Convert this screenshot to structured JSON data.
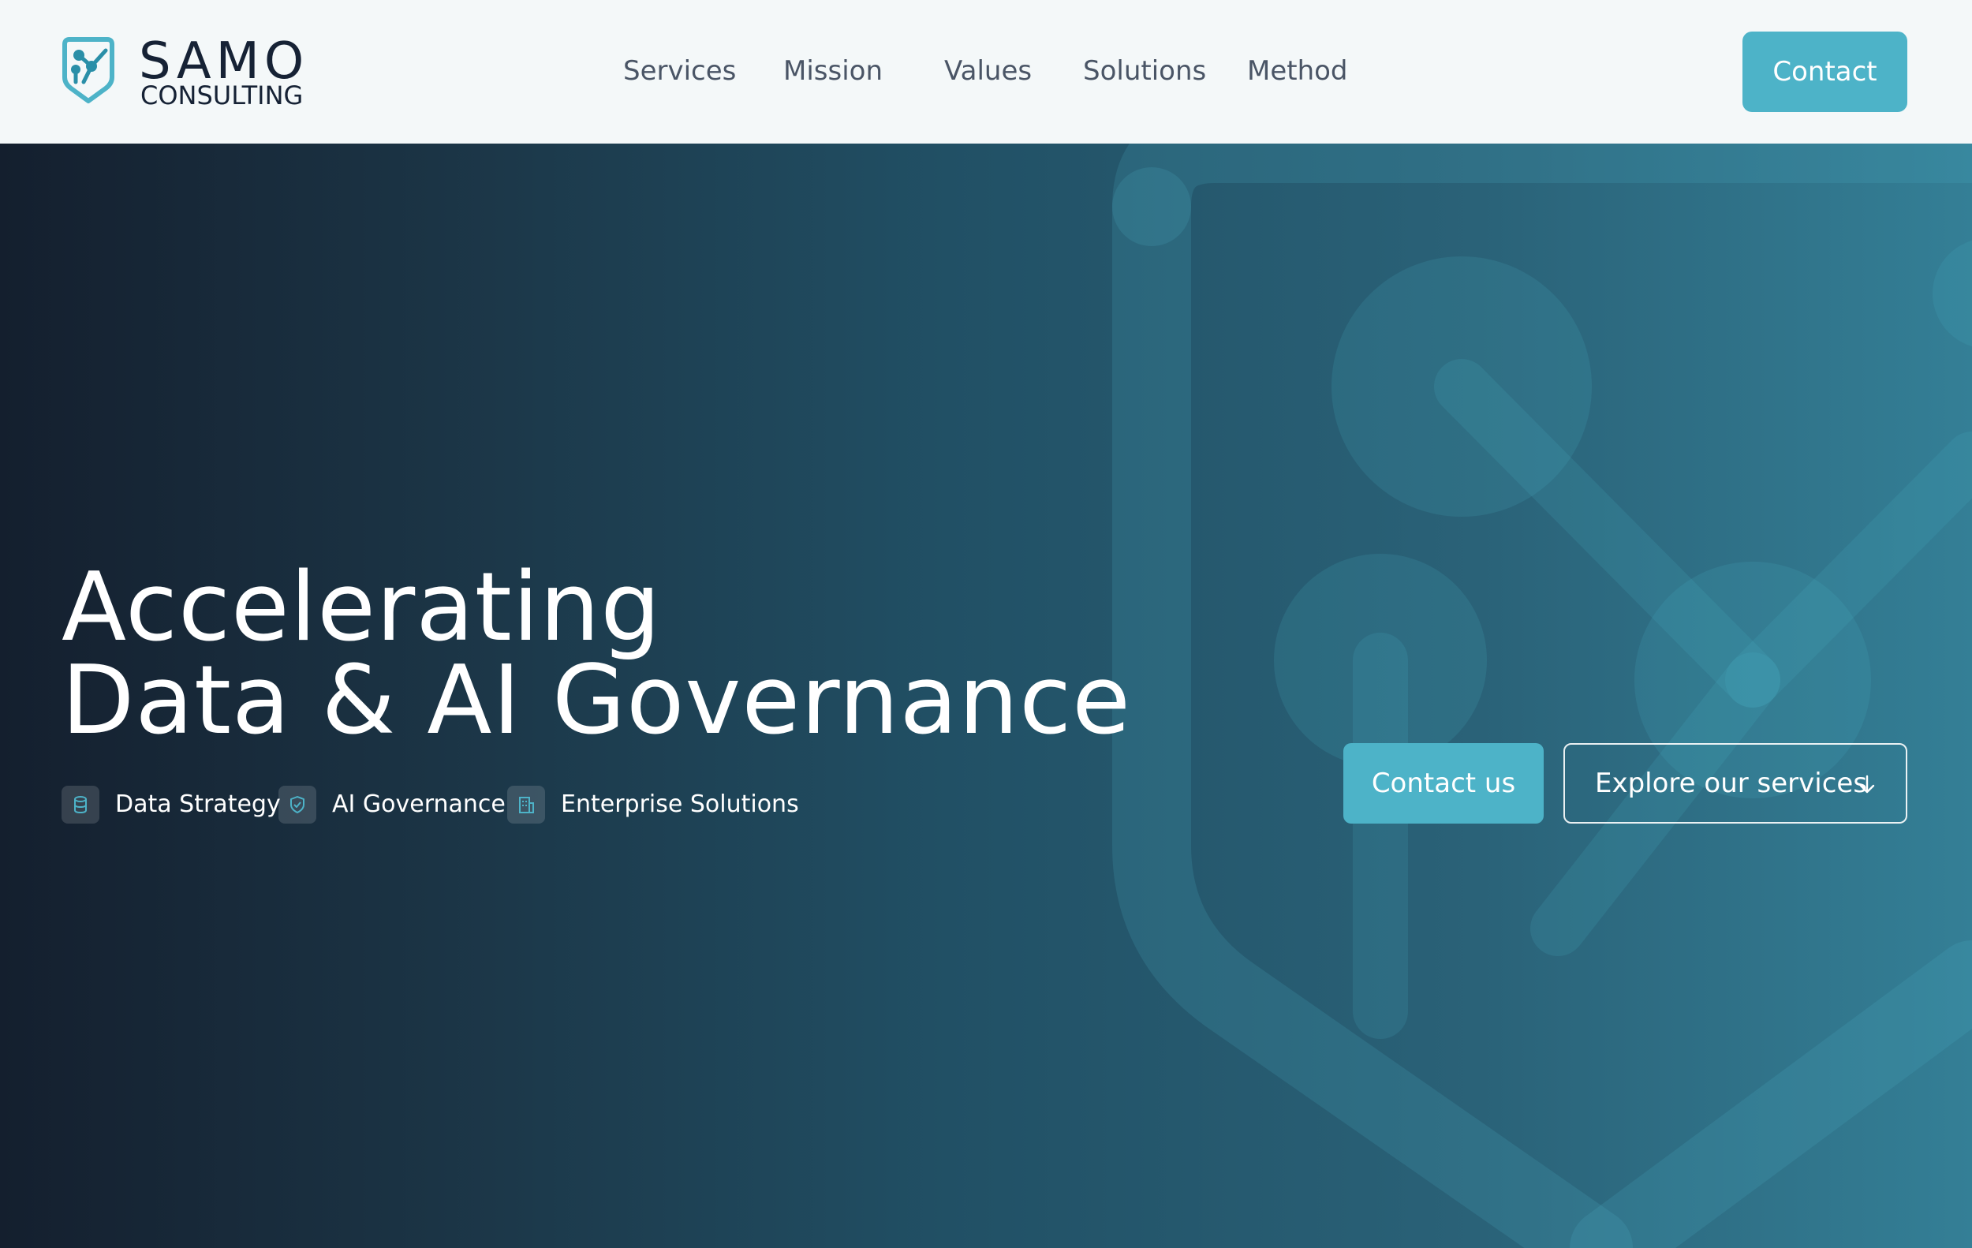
{
  "header": {
    "logo": {
      "name": "SAMO",
      "subtitle": "CONSULTING",
      "icon": "shield-network-logo-icon"
    },
    "nav": [
      {
        "label": "Services"
      },
      {
        "label": "Mission"
      },
      {
        "label": "Values"
      },
      {
        "label": "Solutions"
      },
      {
        "label": "Method"
      }
    ],
    "cta_label": "Contact"
  },
  "hero": {
    "title_line1": "Accelerating",
    "title_line2": "Data & AI Governance",
    "tags": [
      {
        "label": "Data Strategy",
        "icon": "database-icon"
      },
      {
        "label": "AI Governance",
        "icon": "shield-check-icon"
      },
      {
        "label": "Enterprise Solutions",
        "icon": "building-icon"
      }
    ],
    "primary_button": "Contact us",
    "secondary_button": "Explore our services",
    "secondary_button_icon": "arrow-down-icon"
  },
  "colors": {
    "accent": "#4db3c8",
    "header_bg": "#f4f8f9",
    "hero_dark": "#141f2e",
    "hero_light": "#347f96",
    "text_dark": "#162235",
    "nav_text": "#4a5566"
  }
}
